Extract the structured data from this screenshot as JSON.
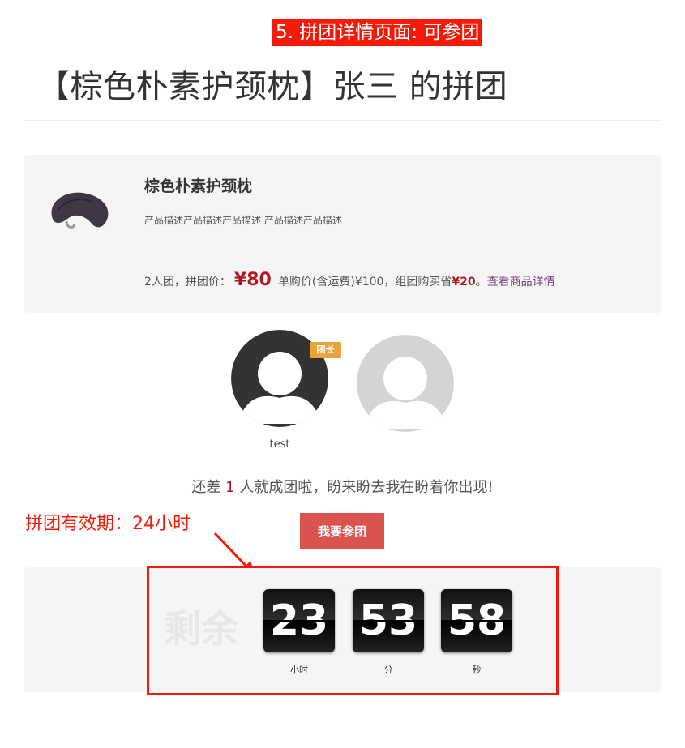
{
  "annotation_banner": "5. 拼团详情页面: 可参团",
  "page_title": "【棕色朴素护颈枕】张三 的拼团",
  "product": {
    "image": "neck-pillow-photo",
    "name": "棕色朴素护颈枕",
    "description": "产品描述产品描述产品描述 产品描述产品描述",
    "group_size_text": "2人团，拼团价：",
    "group_price": "¥80",
    "single_price_text": "单购价(含运费)¥100，组团购买省",
    "save_amount": "¥20",
    "save_suffix": "。",
    "detail_link": "查看商品详情"
  },
  "members": {
    "leader_badge": "团长",
    "leader_name": "test",
    "leader_avatar_icon": "user-avatar-icon",
    "empty_avatar_icon": "empty-slot-avatar-icon"
  },
  "status": {
    "prefix": "还差",
    "count": "1",
    "suffix": "人就成团啦，盼来盼去我在盼着你出现!"
  },
  "join_button": "我要参团",
  "validity_annotation": "拼团有效期：24小时",
  "countdown": {
    "label": "剩余",
    "hours": "23",
    "minutes": "53",
    "seconds": "58",
    "hours_unit": "小时",
    "minutes_unit": "分",
    "seconds_unit": "秒"
  },
  "colors": {
    "annotation_red": "#f31a0a",
    "price_red": "#b2161e",
    "join_button": "#d9534f",
    "leader_badge": "#e9a33a",
    "detail_link": "#7b3f7f"
  }
}
